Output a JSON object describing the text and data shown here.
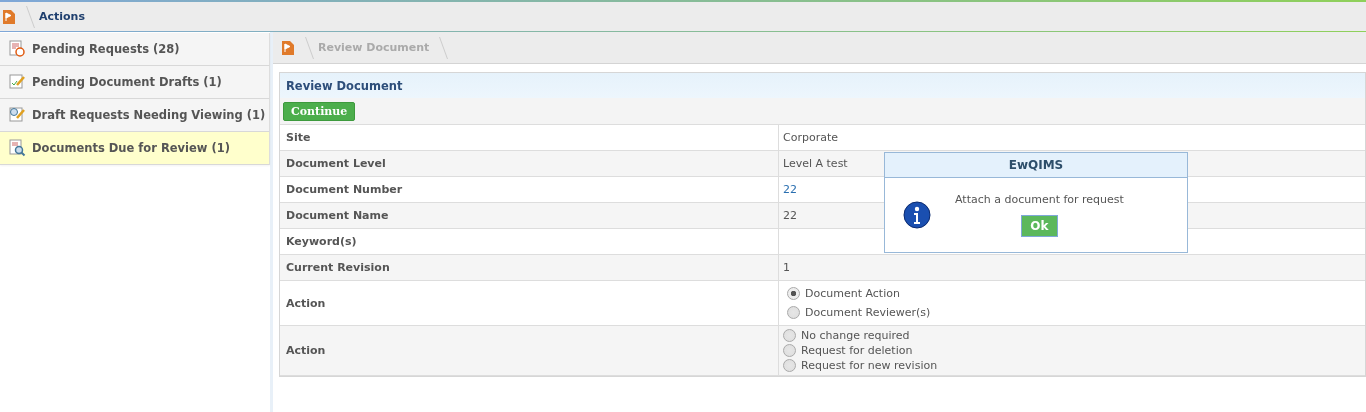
{
  "top_bar": {
    "title": "Actions"
  },
  "sidebar": {
    "items": [
      {
        "label": "Pending Requests (28)",
        "selected": false
      },
      {
        "label": "Pending Document Drafts (1)",
        "selected": false
      },
      {
        "label": "Draft Requests Needing Viewing (1)",
        "selected": false
      },
      {
        "label": "Documents Due for Review (1)",
        "selected": true
      }
    ]
  },
  "breadcrumb": {
    "label": "Review Document"
  },
  "panel": {
    "title": "Review Document",
    "button": "Continue",
    "rows": [
      {
        "label": "Site",
        "kind": "text",
        "value": "Corporate"
      },
      {
        "label": "Document Level",
        "kind": "text",
        "value": "Level A test"
      },
      {
        "label": "Document Number",
        "kind": "link",
        "value": "22"
      },
      {
        "label": "Document Name",
        "kind": "text",
        "value": "22"
      },
      {
        "label": "Keyword(s)",
        "kind": "text"
      },
      {
        "label": "Current Revision",
        "kind": "text",
        "value": "1"
      },
      {
        "label": "Action",
        "kind": "radio",
        "options": [
          {
            "label": "Document Action",
            "selected": true
          },
          {
            "label": "Document Reviewer(s)",
            "selected": false
          }
        ]
      },
      {
        "label": "Action",
        "kind": "radio",
        "options": [
          {
            "label": "No change required",
            "selected": false
          },
          {
            "label": "Request for deletion",
            "selected": false
          },
          {
            "label": "Request for new revision",
            "selected": false
          }
        ]
      }
    ]
  },
  "dialog": {
    "title": "EwQIMS",
    "message": "Attach a document for request",
    "button": "Ok"
  }
}
